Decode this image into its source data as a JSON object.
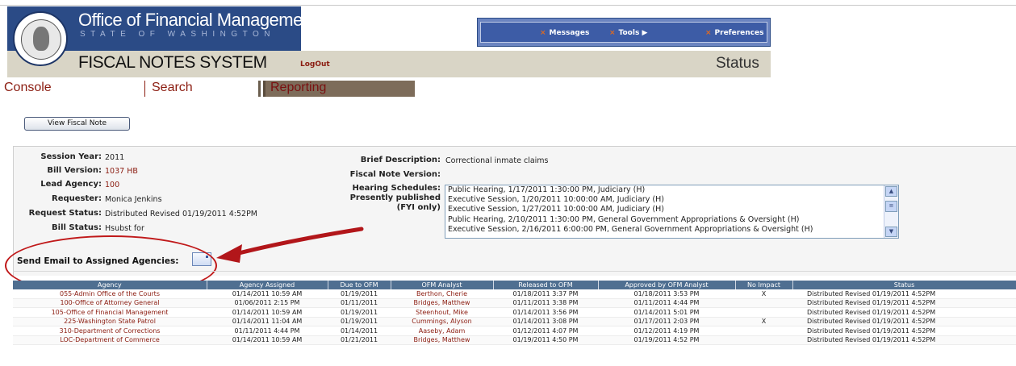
{
  "header": {
    "org_title": "Office of Financial Management",
    "org_subtitle": "STATE OF WASHINGTON",
    "system_title": "FISCAL NOTES SYSTEM",
    "logout_label": "LogOut",
    "page_status_label": "Status",
    "seal_icon": "washington-state-seal-icon"
  },
  "top_nav": [
    {
      "label": "Messages"
    },
    {
      "label": "Tools"
    },
    {
      "label": "Preferences"
    }
  ],
  "tabs": [
    {
      "label": "Console"
    },
    {
      "label": "Search"
    },
    {
      "label": "Reporting"
    }
  ],
  "view_button_label": "View Fiscal Note",
  "details": {
    "session_year_label": "Session Year:",
    "session_year": "2011",
    "bill_version_label": "Bill Version:",
    "bill_version": "1037 HB",
    "lead_agency_label": "Lead Agency:",
    "lead_agency": "100",
    "requester_label": "Requester:",
    "requester": "Monica Jenkins",
    "request_status_label": "Request Status:",
    "request_status": "Distributed Revised 01/19/2011 4:52PM",
    "bill_status_label": "Bill Status:",
    "bill_status": "Hsubst for",
    "brief_desc_label": "Brief Description:",
    "brief_desc": "Correctional inmate claims",
    "fn_version_label": "Fiscal Note Version:",
    "hearing_label_1": "Hearing Schedules:",
    "hearing_label_2": "Presently published",
    "hearing_label_3": "(FYI only)",
    "hearings": [
      "Public Hearing, 1/17/2011 1:30:00 PM, Judiciary (H)",
      "Executive Session, 1/20/2011 10:00:00 AM, Judiciary (H)",
      "Executive Session, 1/27/2011 10:00:00 AM, Judiciary (H)",
      "Public Hearing, 2/10/2011 1:30:00 PM, General Government Appropriations & Oversight (H)",
      "Executive Session, 2/16/2011 6:00:00 PM, General Government Appropriations & Oversight (H)"
    ],
    "send_email_label": "Send Email to Assigned Agencies:"
  },
  "table": {
    "columns": [
      "Agency",
      "Agency Assigned",
      "Due to OFM",
      "OFM Analyst",
      "Released to OFM",
      "Approved by OFM Analyst",
      "No Impact",
      "Status"
    ],
    "rows": [
      [
        "055-Admin Office of the Courts",
        "01/14/2011 10:59 AM",
        "01/19/2011",
        "Berthon, Cherie",
        "01/18/2011 3:37 PM",
        "01/18/2011 3:53 PM",
        "X",
        "Distributed Revised 01/19/2011 4:52PM"
      ],
      [
        "100-Office of Attorney General",
        "01/06/2011 2:15 PM",
        "01/11/2011",
        "Bridges, Matthew",
        "01/11/2011 3:38 PM",
        "01/11/2011 4:44 PM",
        "",
        "Distributed Revised 01/19/2011 4:52PM"
      ],
      [
        "105-Office of Financial Management",
        "01/14/2011 10:59 AM",
        "01/19/2011",
        "Steenhout, Mike",
        "01/14/2011 3:56 PM",
        "01/14/2011 5:01 PM",
        "",
        "Distributed Revised 01/19/2011 4:52PM"
      ],
      [
        "225-Washington State Patrol",
        "01/14/2011 11:04 AM",
        "01/19/2011",
        "Cummings, Alyson",
        "01/14/2011 3:08 PM",
        "01/17/2011 2:03 PM",
        "X",
        "Distributed Revised 01/19/2011 4:52PM"
      ],
      [
        "310-Department of Corrections",
        "01/11/2011 4:44 PM",
        "01/14/2011",
        "Aaseby, Adam",
        "01/12/2011 4:07 PM",
        "01/12/2011 4:19 PM",
        "",
        "Distributed Revised 01/19/2011 4:52PM"
      ],
      [
        "LOC-Department of Commerce",
        "01/14/2011 10:59 AM",
        "01/21/2011",
        "Bridges, Matthew",
        "01/19/2011 4:50 PM",
        "01/19/2011 4:52 PM",
        "",
        "Distributed Revised 01/19/2011 4:52PM"
      ]
    ]
  },
  "colors": {
    "brand_blue": "#2b4b86",
    "link_red": "#8b1c10",
    "annotation_red": "#c0191a",
    "table_header": "#4f6f91"
  }
}
